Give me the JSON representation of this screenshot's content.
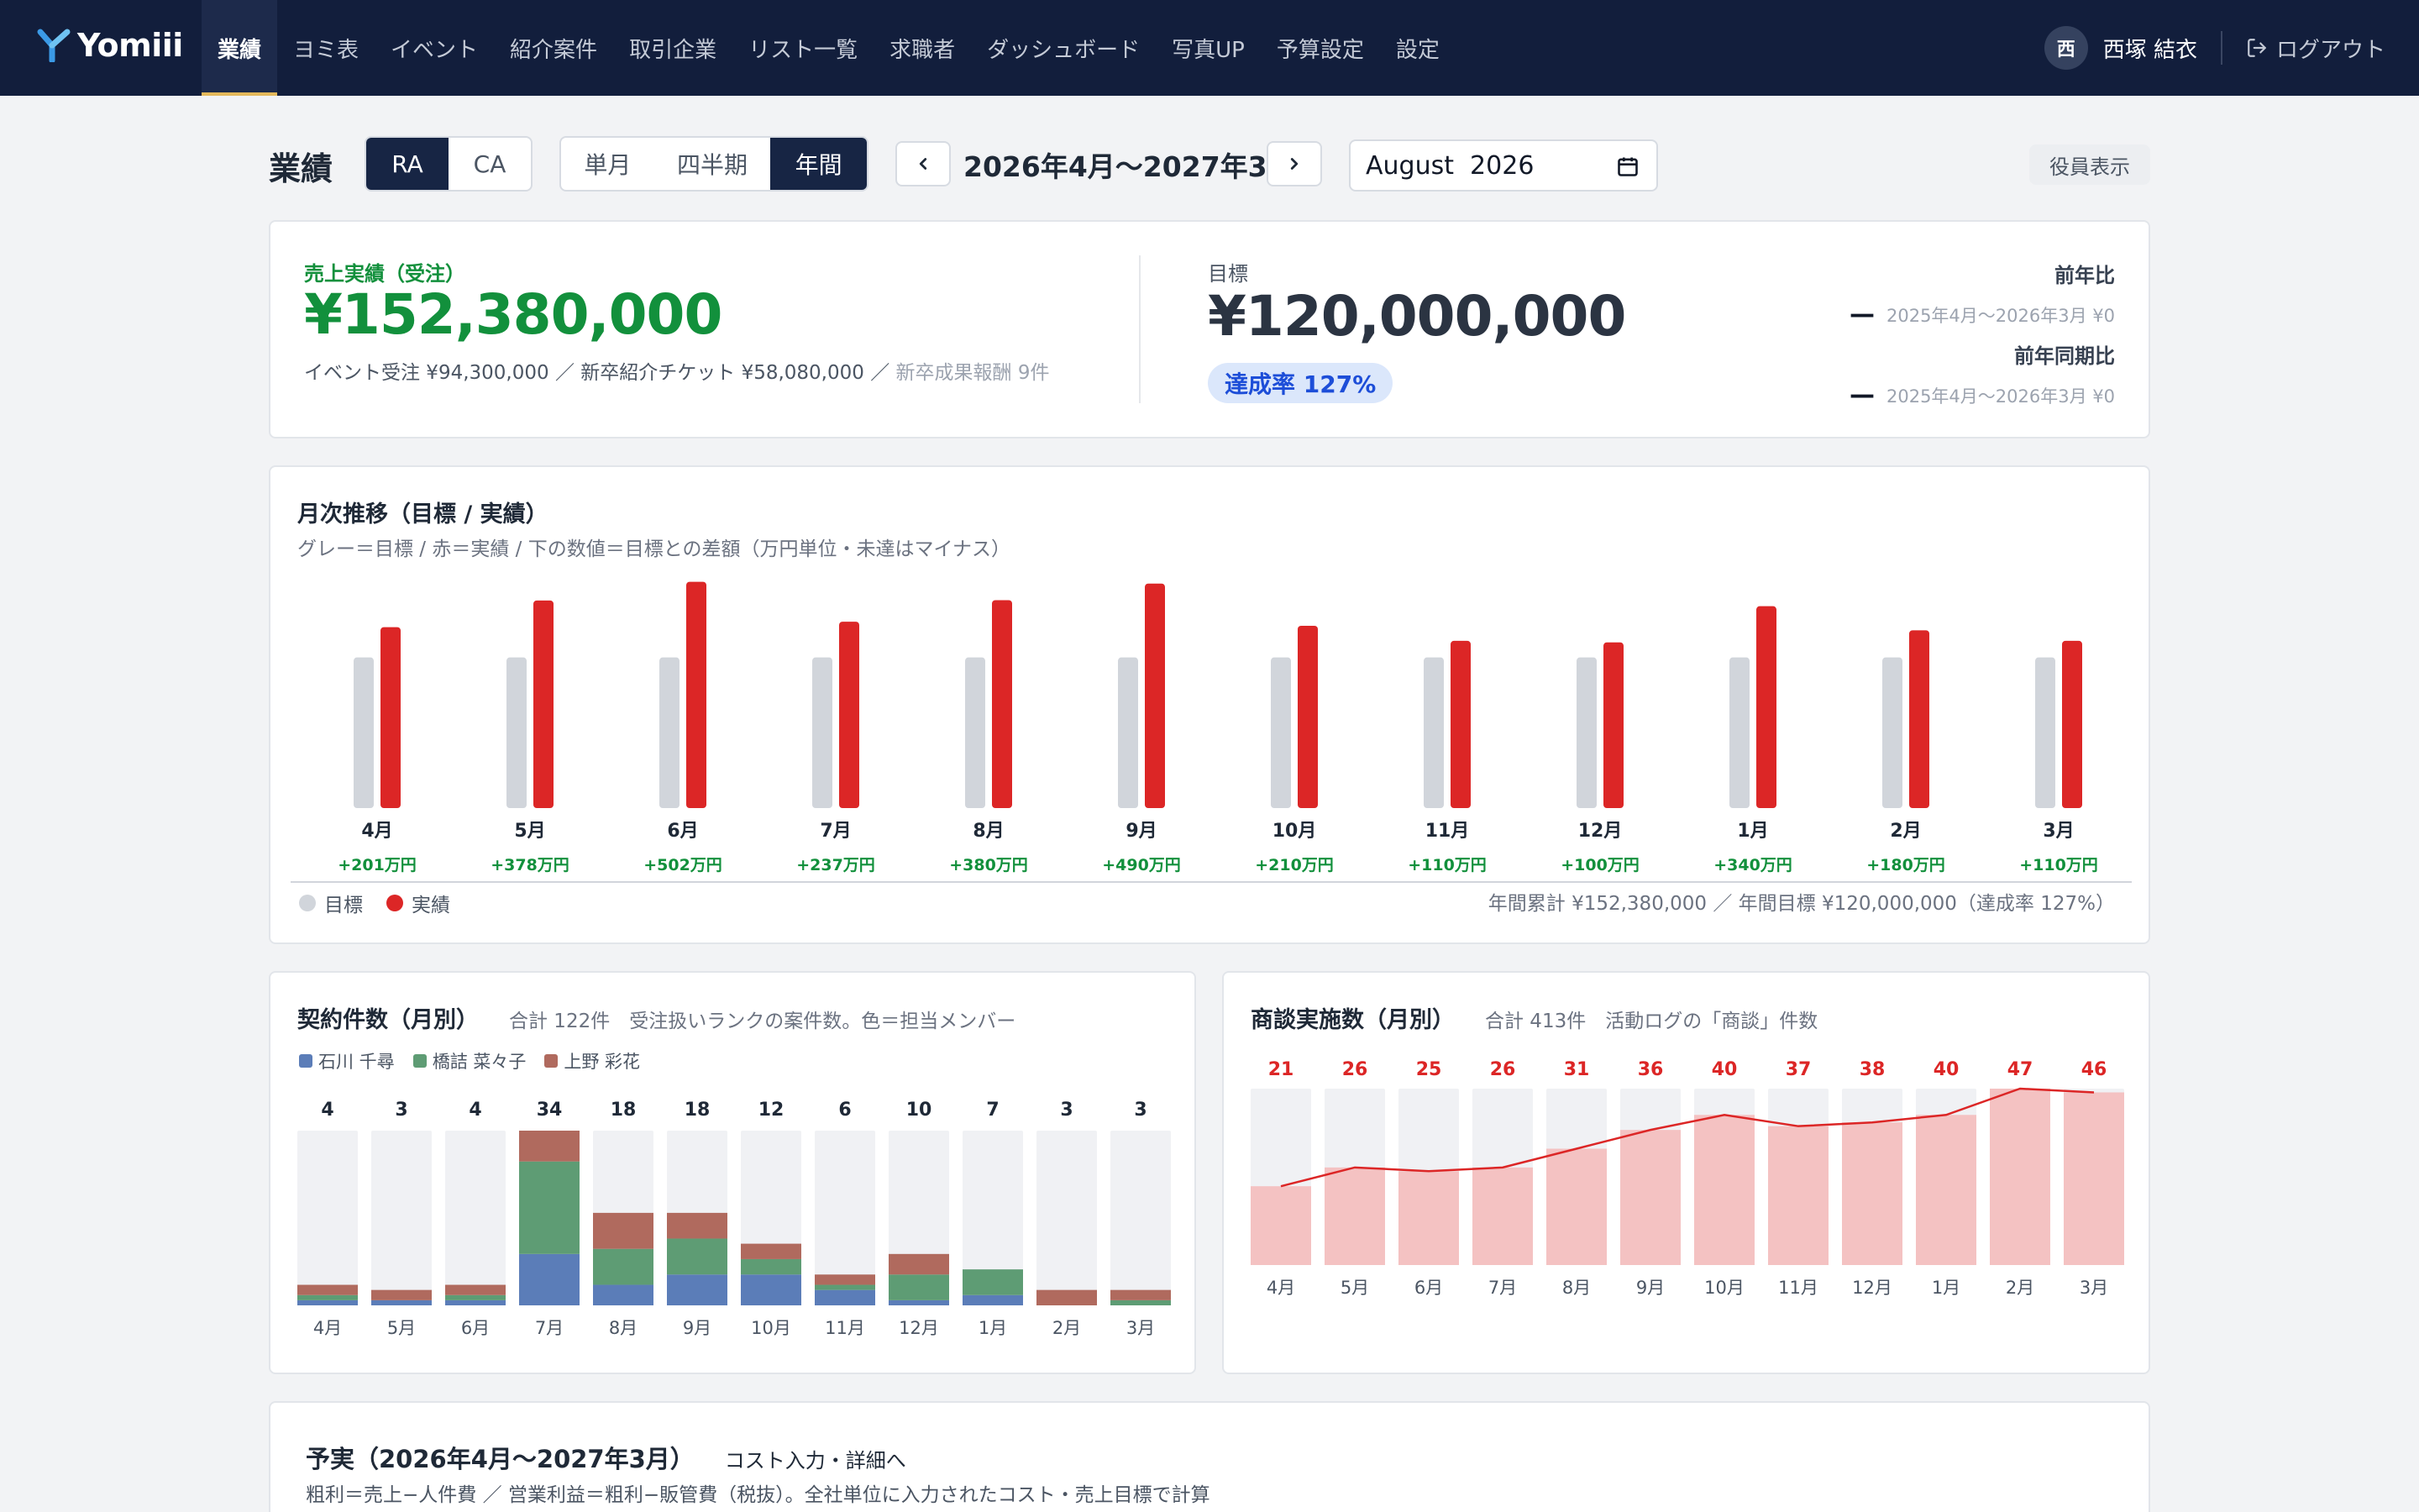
{
  "nav": {
    "logo": "Yomiii",
    "items": [
      "業績",
      "ヨミ表",
      "イベント",
      "紹介案件",
      "取引企業",
      "リスト一覧",
      "求職者",
      "ダッシュボード",
      "写真UP",
      "予算設定",
      "設定"
    ],
    "active": "業績",
    "user_initial": "西",
    "user_name": "西塚 結衣",
    "logout": "ログアウト"
  },
  "toolbar": {
    "title": "業績",
    "ra": "RA",
    "ca": "CA",
    "single": "単月",
    "quarter": "四半期",
    "year": "年間",
    "period": "2026年4月〜2027年3月",
    "month_value": "August  2026",
    "exec_view": "役員表示"
  },
  "kpi": {
    "sales_label": "売上実績（受注）",
    "sales_value": "¥152,380,000",
    "breakdown_main": "イベント受注 ¥94,300,000 ／ 新卒紹介チケット ¥58,080,000 ／",
    "breakdown_muted": " 新卒成果報酬 9件",
    "target_label": "目標",
    "target_value": "¥120,000,000",
    "rate": "達成率 127%",
    "yoy_title": "前年比",
    "yoy_detail": "2025年4月〜2026年3月 ¥0",
    "yoy2_title": "前年同期比",
    "yoy2_detail": "2025年4月〜2026年3月 ¥0",
    "dash": "—"
  },
  "monthly": {
    "title": "月次推移（目標 / 実績）",
    "desc": "グレー＝目標 / 赤＝実績 / 下の数値＝目標との差額（万円単位・未達はマイナス）",
    "legend_target": "目標",
    "legend_actual": "実績",
    "summary": "年間累計 ¥152,380,000 ／ 年間目標 ¥120,000,000（達成率 127%）"
  },
  "contracts": {
    "title": "契約件数（月別）",
    "note": "合計 122件　受注扱いランクの案件数。色＝担当メンバー"
  },
  "meetings": {
    "title": "商談実施数（月別）",
    "note": "合計 413件　活動ログの「商談」件数"
  },
  "budget": {
    "title": "予実（2026年4月〜2027年3月）",
    "link": "コスト入力・詳細へ",
    "desc": "粗利＝売上−人件費 ／ 営業利益＝粗利−販管費（税抜）。全社単位に入力されたコスト・売上目標で計算"
  },
  "colors": {
    "navy": "#121e3c",
    "green": "#12903c",
    "red": "#dc2626",
    "target_gray": "#d1d5db",
    "member1": "#5b7db8",
    "member2": "#5e9c74",
    "member3": "#b06a5e"
  },
  "chart_data": [
    {
      "type": "bar",
      "title": "月次推移（目標 / 実績）",
      "categories": [
        "4月",
        "5月",
        "6月",
        "7月",
        "8月",
        "9月",
        "10月",
        "11月",
        "12月",
        "1月",
        "2月",
        "3月"
      ],
      "series": [
        {
          "name": "目標",
          "values": [
            1000,
            1000,
            1000,
            1000,
            1000,
            1000,
            1000,
            1000,
            1000,
            1000,
            1000,
            1000
          ]
        },
        {
          "name": "実績",
          "values": [
            1201,
            1378,
            1502,
            1237,
            1380,
            1490,
            1210,
            1110,
            1100,
            1340,
            1180,
            1110
          ]
        }
      ],
      "diff_labels": [
        "+201万円",
        "+378万円",
        "+502万円",
        "+237万円",
        "+380万円",
        "+490万円",
        "+210万円",
        "+110万円",
        "+100万円",
        "+340万円",
        "+180万円",
        "+110万円"
      ],
      "ylim": [
        0,
        1550
      ]
    },
    {
      "type": "bar",
      "title": "契約件数（月別）",
      "stacked": true,
      "categories": [
        "4月",
        "5月",
        "6月",
        "7月",
        "8月",
        "9月",
        "10月",
        "11月",
        "12月",
        "1月",
        "2月",
        "3月"
      ],
      "totals": [
        4,
        3,
        4,
        34,
        18,
        18,
        12,
        6,
        10,
        7,
        3,
        3
      ],
      "series": [
        {
          "name": "石川 千尋",
          "values": [
            1,
            1,
            1,
            10,
            4,
            6,
            6,
            3,
            1,
            2,
            0,
            0
          ]
        },
        {
          "name": "橋詰 菜々子",
          "values": [
            1,
            0,
            1,
            18,
            7,
            7,
            3,
            1,
            5,
            5,
            0,
            1
          ]
        },
        {
          "name": "上野 彩花",
          "values": [
            2,
            2,
            2,
            6,
            7,
            5,
            3,
            2,
            4,
            0,
            3,
            2
          ]
        }
      ],
      "ylim": [
        0,
        34
      ]
    },
    {
      "type": "bar",
      "title": "商談実施数（月別）",
      "categories": [
        "4月",
        "5月",
        "6月",
        "7月",
        "8月",
        "9月",
        "10月",
        "11月",
        "12月",
        "1月",
        "2月",
        "3月"
      ],
      "values": [
        21,
        26,
        25,
        26,
        31,
        36,
        40,
        37,
        38,
        40,
        47,
        46
      ],
      "ylim": [
        0,
        47
      ]
    }
  ]
}
